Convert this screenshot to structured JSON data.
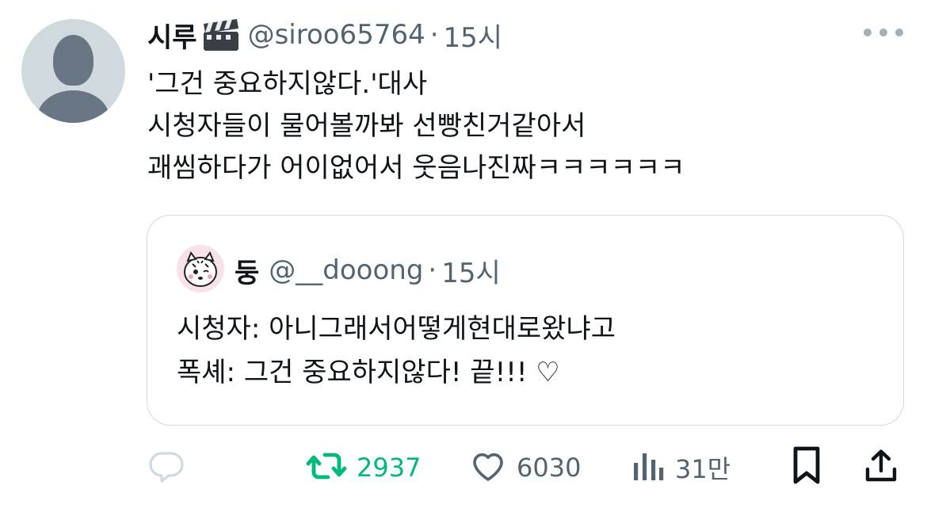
{
  "author": {
    "name": "시루",
    "handle": "@siroo65764",
    "separator": "·",
    "time": "15시",
    "name_emoji_icon": "clapper-board-icon"
  },
  "tweet": {
    "lines": [
      "'그건 중요하지않다.'대사",
      "시청자들이 물어볼까봐 선빵친거같아서",
      "괘씸하다가 어이없어서 웃음나진짜ㅋㅋㅋㅋㅋㅋ"
    ]
  },
  "quoted": {
    "name": "둥",
    "handle": "@__dooong",
    "separator": "·",
    "time": "15시",
    "lines": [
      "시청자: 아니그래서어떻게현대로왔냐고",
      "폭셰: 그건 중요하지않다! 끝!!! ♡"
    ]
  },
  "actions": {
    "reply_icon": "reply-icon",
    "retweet_icon": "retweet-icon",
    "retweet_count": "2937",
    "like_icon": "heart-icon",
    "like_count": "6030",
    "views_icon": "views-icon",
    "views_count": "31만",
    "bookmark_icon": "bookmark-icon",
    "share_icon": "share-icon"
  },
  "colors": {
    "text": "#0f1419",
    "secondary": "#536471",
    "retweet_green": "#00ba7c",
    "border": "#cfd9de",
    "reply_icon_light": "#cfd9de"
  }
}
